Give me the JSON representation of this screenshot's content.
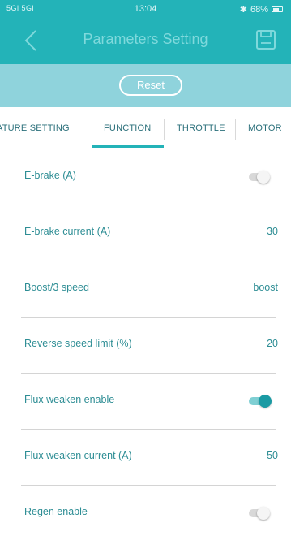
{
  "status_bar": {
    "signal": "5Gl 5Gl",
    "time": "13:04",
    "battery": "68%"
  },
  "nav": {
    "title": "Parameters Setting"
  },
  "reset_label": "Reset",
  "tabs": [
    {
      "label": "ATURE SETTING"
    },
    {
      "label": "FUNCTION",
      "active": true
    },
    {
      "label": "THROTTLE"
    },
    {
      "label": "MOTOR"
    }
  ],
  "rows": [
    {
      "label": "E-brake (A)",
      "toggle": "off"
    },
    {
      "label": "E-brake current (A)",
      "value": "30"
    },
    {
      "label": "Boost/3 speed",
      "value": "boost"
    },
    {
      "label": "Reverse speed limit (%)",
      "value": "20"
    },
    {
      "label": "Flux weaken enable",
      "toggle": "on"
    },
    {
      "label": "Flux weaken current (A)",
      "value": "50"
    },
    {
      "label": "Regen enable",
      "toggle": "off"
    }
  ],
  "colors": {
    "header": "#23b3b8",
    "reset_bar": "#8fd3dc",
    "text": "#2d8d94",
    "toggle_on": "#1a9aa3"
  }
}
